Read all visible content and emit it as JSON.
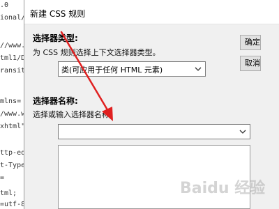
{
  "editor": {
    "lines": [
      ".0",
      "ional//",
      "",
      "//www.w3",
      "tml1/DT",
      "ransiti",
      "",
      "",
      "mlns=",
      "/www.w3",
      "xhtml\">",
      "",
      "",
      "ttp-equ",
      "t-Type'",
      "=",
      "tml;",
      "=utf-8'"
    ]
  },
  "dialog": {
    "title": "新建 CSS 规则",
    "selector_type": {
      "label": "选择器类型:",
      "hint": "为 CSS 规则选择上下文选择器类型。",
      "selected": "类(可应用于任何 HTML 元素)"
    },
    "selector_name": {
      "label": "选择器名称:",
      "hint": "选择或输入选择器名称。",
      "value": ""
    },
    "buttons": [
      {
        "label": "确定"
      },
      {
        "label": "取消"
      }
    ]
  },
  "watermark": "Baidu 经验",
  "colors": {
    "annotation_arrow": "#e02020"
  }
}
